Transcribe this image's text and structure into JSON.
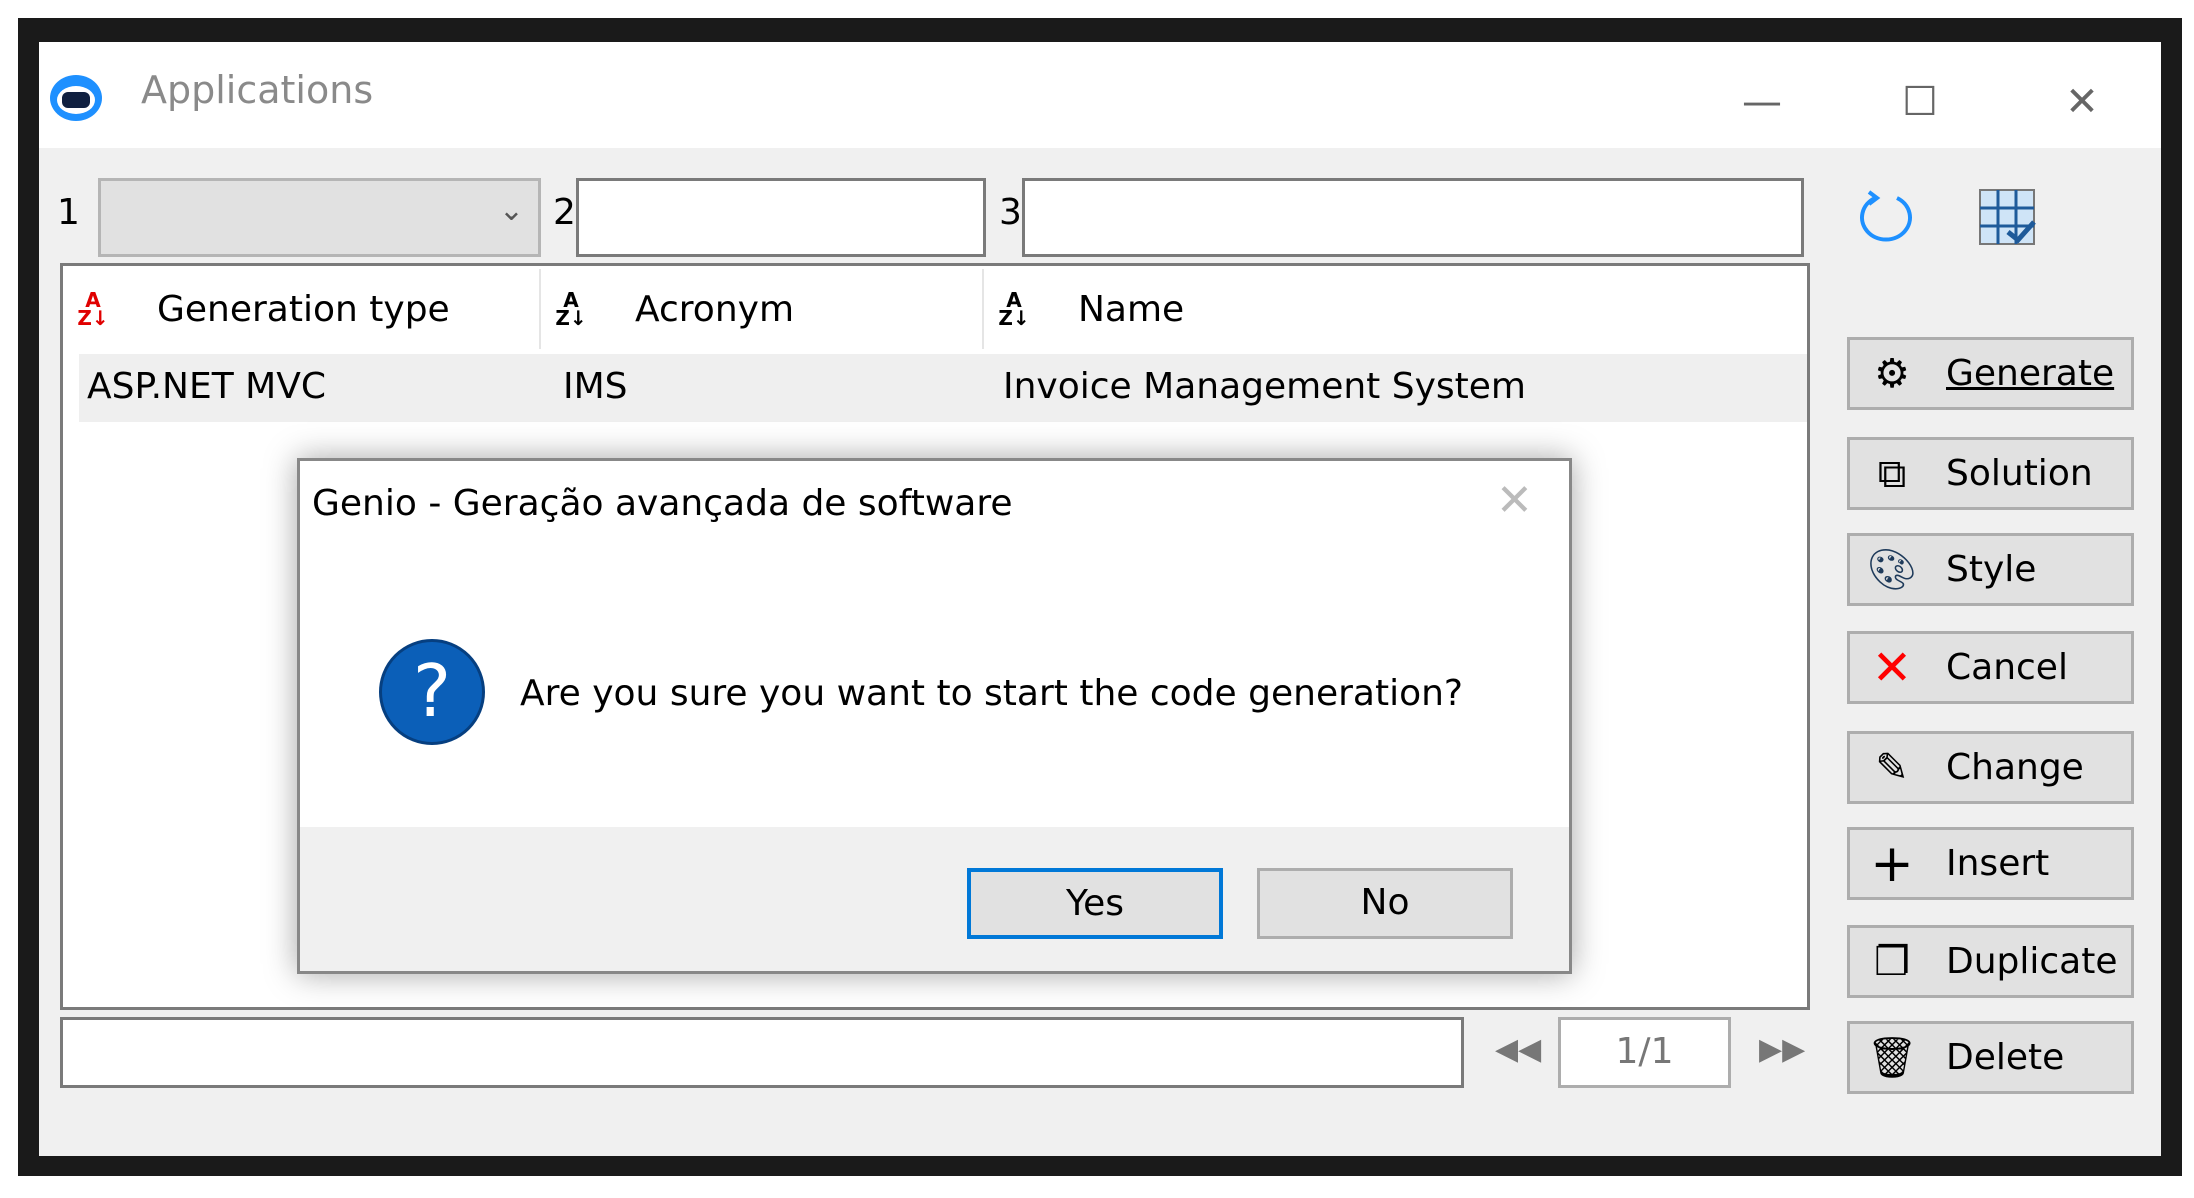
{
  "window": {
    "title": "Applications",
    "minimize": "—",
    "maximize": "☐",
    "close": "✕"
  },
  "filters": [
    {
      "label": "1",
      "value": ""
    },
    {
      "label": "2",
      "value": ""
    },
    {
      "label": "3",
      "value": ""
    }
  ],
  "grid": {
    "columns": [
      "Generation type",
      "Acronym",
      "Name"
    ],
    "rows": [
      [
        "ASP.NET MVC",
        "IMS",
        "Invoice Management System"
      ]
    ]
  },
  "buttons": [
    "Generate",
    "Solution",
    "Style",
    "Cancel",
    "Change",
    "Insert",
    "Duplicate",
    "Delete"
  ],
  "pager": {
    "page": "1/1",
    "prev": "◀◀",
    "next": "▶▶"
  },
  "dialog": {
    "title": "Genio - Geração avançada de software",
    "message": "Are you sure you want to start the code generation?",
    "yes": "Yes",
    "no": "No",
    "icon": "?"
  },
  "colors": {
    "accent": "#0078d7",
    "cancel": "#ff0000",
    "sort_active": "#e00000"
  }
}
